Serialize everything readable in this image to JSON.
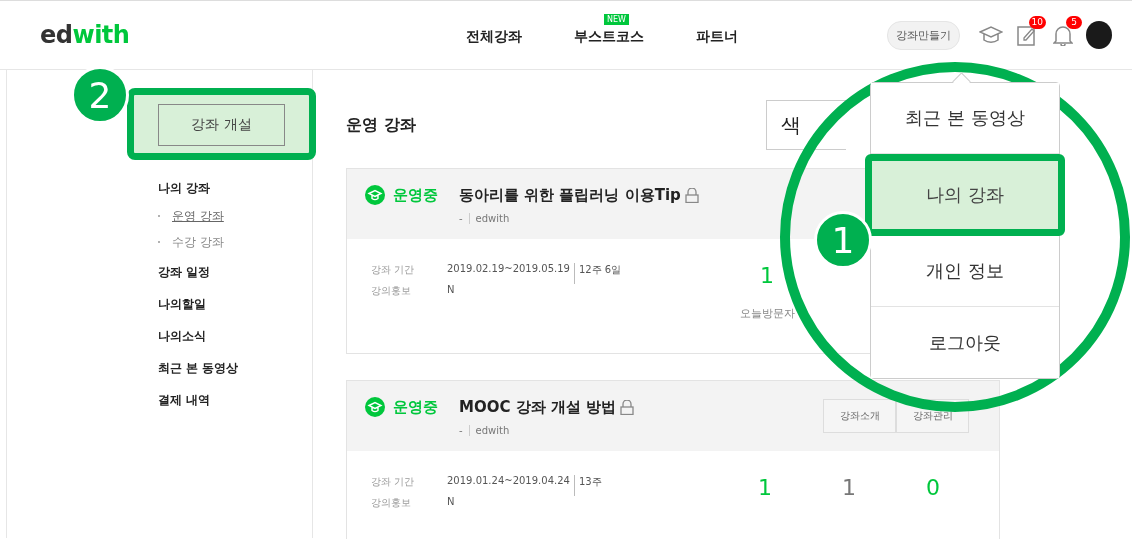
{
  "header": {
    "logo": [
      "ed",
      "with"
    ],
    "nav": [
      {
        "label": "전체강좌"
      },
      {
        "label": "부스트코스",
        "badge": "NEW"
      },
      {
        "label": "파트너"
      }
    ],
    "create_button": "강좌만들기",
    "icons": [
      {
        "kind": "cap"
      },
      {
        "kind": "edit",
        "count": "10"
      },
      {
        "kind": "bell",
        "count": "5"
      },
      {
        "kind": "avatar"
      }
    ]
  },
  "sidebar": {
    "open_course_button": "강좌 개설",
    "highlighted": true,
    "menu": [
      {
        "label": "나의 강좌",
        "children": [
          {
            "label": "운영 강좌",
            "selected": true
          },
          {
            "label": "수강 강좌",
            "selected": false
          }
        ]
      },
      {
        "label": "강좌 일정"
      },
      {
        "label": "나의할일"
      },
      {
        "label": "나의소식"
      },
      {
        "label": "최근 본 동영상"
      },
      {
        "label": "결제 내역"
      }
    ]
  },
  "main": {
    "title": "운영 강좌",
    "search_fragment": "색",
    "courses": [
      {
        "status": "운영중",
        "title": "동아리를 위한 플립러닝 이용Tip",
        "locked": true,
        "meta": [
          "-",
          "edwith"
        ],
        "info": [
          {
            "label": "강좌 기간",
            "value": [
              "2019.02.19~2019.05.19",
              "12주 6일"
            ]
          },
          {
            "label": "강의홍보",
            "value": [
              "N"
            ]
          }
        ],
        "stats": [
          {
            "value": "1",
            "label": "오늘방문자",
            "highlight": true
          }
        ]
      },
      {
        "status": "운영중",
        "title": "MOOC 강좌 개설 방법",
        "locked": true,
        "meta": [
          "-",
          "edwith"
        ],
        "info": [
          {
            "label": "강좌 기간",
            "value": [
              "2019.01.24~2019.04.24",
              "13주"
            ]
          },
          {
            "label": "강의홍보",
            "value": [
              "N"
            ]
          }
        ],
        "buttons": [
          "강좌소개",
          "강좌관리"
        ],
        "stats": [
          {
            "value": "1",
            "highlight": true
          },
          {
            "value": "1",
            "highlight": false
          },
          {
            "value": "0",
            "highlight": true
          }
        ]
      }
    ]
  },
  "dropdown": [
    {
      "label": "최근 본 동영상",
      "highlighted": false
    },
    {
      "label": "나의 강좌",
      "highlighted": true
    },
    {
      "label": "개인 정보",
      "highlighted": false
    },
    {
      "label": "로그아웃",
      "highlighted": false
    }
  ],
  "annotations": [
    "1",
    "2"
  ]
}
